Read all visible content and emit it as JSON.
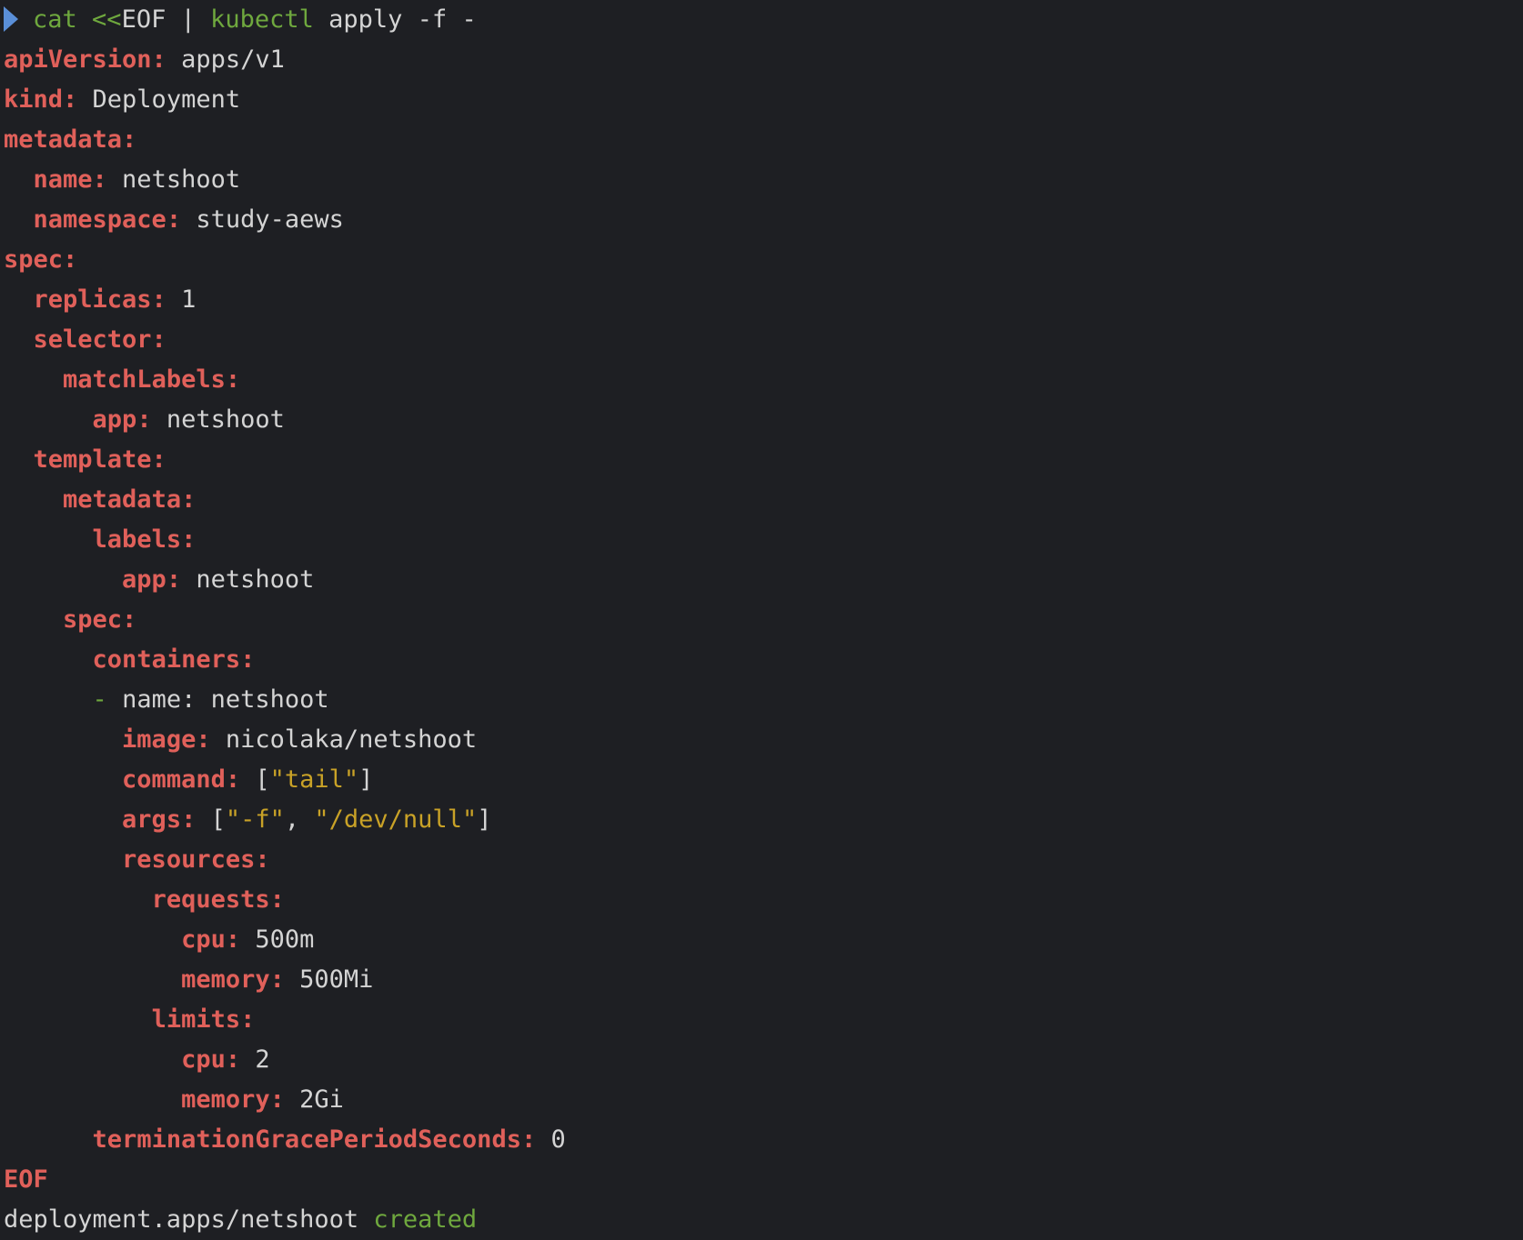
{
  "terminal": {
    "background": "#1e1f23",
    "colors": {
      "prompt": "#5a8fd8",
      "key": "#e0605a",
      "value": "#d4d4d4",
      "command": "#6fa83e",
      "string": "#c9a227",
      "success": "#6fa83e"
    },
    "prompt_icon": "prompt-arrow-icon",
    "lines": [
      {
        "indent": "",
        "segments": [
          {
            "text": "cat",
            "style": "c-cmd"
          },
          {
            "text": " <<",
            "style": "c-cmd"
          },
          {
            "text": "EOF | ",
            "style": "c-op"
          },
          {
            "text": "kubectl",
            "style": "c-cmd"
          },
          {
            "text": " apply -f -",
            "style": "c-op"
          }
        ],
        "prompt": true
      },
      {
        "indent": "",
        "segments": [
          {
            "text": "apiVersion:",
            "style": "c-key"
          },
          {
            "text": " apps/v1",
            "style": "c-val"
          }
        ]
      },
      {
        "indent": "",
        "segments": [
          {
            "text": "kind:",
            "style": "c-key"
          },
          {
            "text": " Deployment",
            "style": "c-val"
          }
        ]
      },
      {
        "indent": "",
        "segments": [
          {
            "text": "metadata:",
            "style": "c-key"
          }
        ]
      },
      {
        "indent": "  ",
        "segments": [
          {
            "text": "name:",
            "style": "c-key"
          },
          {
            "text": " netshoot",
            "style": "c-val"
          }
        ]
      },
      {
        "indent": "  ",
        "segments": [
          {
            "text": "namespace:",
            "style": "c-key"
          },
          {
            "text": " study-aews",
            "style": "c-val"
          }
        ]
      },
      {
        "indent": "",
        "segments": [
          {
            "text": "spec:",
            "style": "c-key"
          }
        ]
      },
      {
        "indent": "  ",
        "segments": [
          {
            "text": "replicas:",
            "style": "c-key"
          },
          {
            "text": " 1",
            "style": "c-val"
          }
        ]
      },
      {
        "indent": "  ",
        "segments": [
          {
            "text": "selector:",
            "style": "c-key"
          }
        ]
      },
      {
        "indent": "    ",
        "segments": [
          {
            "text": "matchLabels:",
            "style": "c-key"
          }
        ]
      },
      {
        "indent": "      ",
        "segments": [
          {
            "text": "app:",
            "style": "c-key"
          },
          {
            "text": " netshoot",
            "style": "c-val"
          }
        ]
      },
      {
        "indent": "  ",
        "segments": [
          {
            "text": "template:",
            "style": "c-key"
          }
        ]
      },
      {
        "indent": "    ",
        "segments": [
          {
            "text": "metadata:",
            "style": "c-key"
          }
        ]
      },
      {
        "indent": "      ",
        "segments": [
          {
            "text": "labels:",
            "style": "c-key"
          }
        ]
      },
      {
        "indent": "        ",
        "segments": [
          {
            "text": "app:",
            "style": "c-key"
          },
          {
            "text": " netshoot",
            "style": "c-val"
          }
        ]
      },
      {
        "indent": "    ",
        "segments": [
          {
            "text": "spec:",
            "style": "c-key"
          }
        ]
      },
      {
        "indent": "      ",
        "segments": [
          {
            "text": "containers:",
            "style": "c-key"
          }
        ]
      },
      {
        "indent": "      ",
        "segments": [
          {
            "text": "-",
            "style": "c-cmd"
          },
          {
            "text": " name: netshoot",
            "style": "c-val"
          }
        ]
      },
      {
        "indent": "        ",
        "segments": [
          {
            "text": "image:",
            "style": "c-key"
          },
          {
            "text": " nicolaka/netshoot",
            "style": "c-val"
          }
        ]
      },
      {
        "indent": "        ",
        "segments": [
          {
            "text": "command:",
            "style": "c-key"
          },
          {
            "text": " [",
            "style": "c-val"
          },
          {
            "text": "\"tail\"",
            "style": "c-str"
          },
          {
            "text": "]",
            "style": "c-val"
          }
        ]
      },
      {
        "indent": "        ",
        "segments": [
          {
            "text": "args:",
            "style": "c-key"
          },
          {
            "text": " [",
            "style": "c-val"
          },
          {
            "text": "\"-f\"",
            "style": "c-str"
          },
          {
            "text": ", ",
            "style": "c-val"
          },
          {
            "text": "\"/dev/null\"",
            "style": "c-str"
          },
          {
            "text": "]",
            "style": "c-val"
          }
        ]
      },
      {
        "indent": "        ",
        "segments": [
          {
            "text": "resources:",
            "style": "c-key"
          }
        ]
      },
      {
        "indent": "          ",
        "segments": [
          {
            "text": "requests:",
            "style": "c-key"
          }
        ]
      },
      {
        "indent": "            ",
        "segments": [
          {
            "text": "cpu:",
            "style": "c-key"
          },
          {
            "text": " 500m",
            "style": "c-val"
          }
        ]
      },
      {
        "indent": "            ",
        "segments": [
          {
            "text": "memory:",
            "style": "c-key"
          },
          {
            "text": " 500Mi",
            "style": "c-val"
          }
        ]
      },
      {
        "indent": "          ",
        "segments": [
          {
            "text": "limits:",
            "style": "c-key"
          }
        ]
      },
      {
        "indent": "            ",
        "segments": [
          {
            "text": "cpu:",
            "style": "c-key"
          },
          {
            "text": " 2",
            "style": "c-val"
          }
        ]
      },
      {
        "indent": "            ",
        "segments": [
          {
            "text": "memory:",
            "style": "c-key"
          },
          {
            "text": " 2Gi",
            "style": "c-val"
          }
        ]
      },
      {
        "indent": "      ",
        "segments": [
          {
            "text": "terminationGracePeriodSeconds:",
            "style": "c-key"
          },
          {
            "text": " 0",
            "style": "c-val"
          }
        ]
      },
      {
        "indent": "",
        "segments": [
          {
            "text": "EOF",
            "style": "c-key"
          }
        ]
      },
      {
        "indent": "",
        "segments": [
          {
            "text": "deployment.apps/netshoot",
            "style": "c-val"
          },
          {
            "text": " created",
            "style": "c-ok"
          }
        ]
      }
    ]
  }
}
